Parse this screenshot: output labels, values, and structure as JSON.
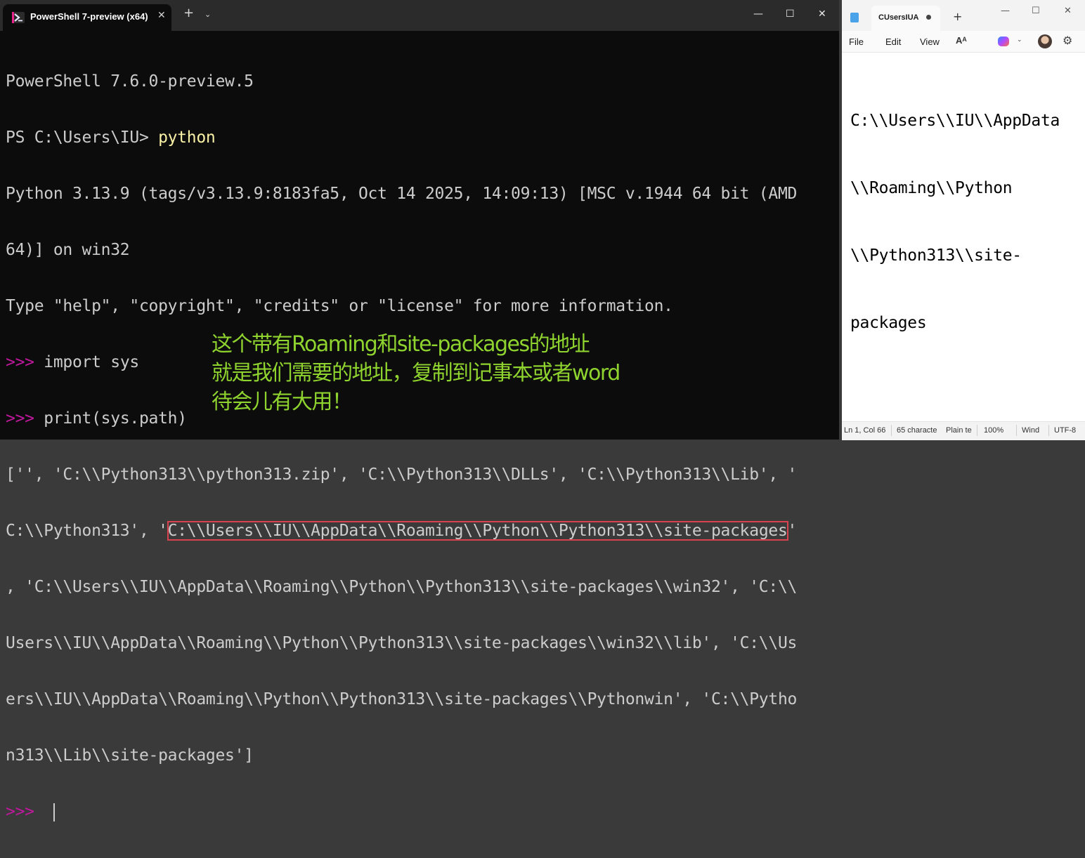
{
  "terminal": {
    "tab_title": "PowerShell 7-preview (x64)",
    "tab_close": "✕",
    "new_tab": "+",
    "dropdown": "⌄",
    "win_minimize": "—",
    "win_maximize": "☐",
    "win_close": "✕",
    "lines": [
      {
        "text": "PowerShell 7.6.0-preview.5"
      },
      {
        "prompt": "PS C:\\Users\\IU> ",
        "cmd": "python"
      },
      {
        "text": "Python 3.13.9 (tags/v3.13.9:8183fa5, Oct 14 2025, 14:09:13) [MSC v.1944 64 bit (AMD"
      },
      {
        "text": "64)] on win32"
      },
      {
        "text": "Type \"help\", \"copyright\", \"credits\" or \"license\" for more information."
      },
      {
        "prompt": ">>> ",
        "text": "import sys"
      },
      {
        "prompt": ">>> ",
        "text": "print(sys.path)"
      },
      {
        "text": "['', 'C:\\\\Python313\\\\python313.zip', 'C:\\\\Python313\\\\DLLs', 'C:\\\\Python313\\\\Lib', '"
      },
      {
        "pre": "C:\\\\Python313', '",
        "highlight": "C:\\\\Users\\\\IU\\\\AppData\\\\Roaming\\\\Python\\\\Python313\\\\site-packages",
        "post": "'"
      },
      {
        "text": ", 'C:\\\\Users\\\\IU\\\\AppData\\\\Roaming\\\\Python\\\\Python313\\\\site-packages\\\\win32', 'C:\\\\"
      },
      {
        "text": "Users\\\\IU\\\\AppData\\\\Roaming\\\\Python\\\\Python313\\\\site-packages\\\\win32\\\\lib', 'C:\\\\Us"
      },
      {
        "text": "ers\\\\IU\\\\AppData\\\\Roaming\\\\Python\\\\Python313\\\\site-packages\\\\Pythonwin', 'C:\\\\Pytho"
      },
      {
        "text": "n313\\\\Lib\\\\site-packages']"
      }
    ],
    "last_prompt": ">>> "
  },
  "annotation": {
    "line1": "这个带有Roaming和site-packages的地址",
    "line2": "就是我们需要的地址，复制到记事本或者word",
    "line3": "待会儿有大用！"
  },
  "notepad": {
    "tab_title": "CUsersIUA",
    "new_tab": "+",
    "win_minimize": "—",
    "win_maximize": "☐",
    "win_close": "✕",
    "menu": {
      "file": "File",
      "edit": "Edit",
      "view": "View"
    },
    "font_icon_text": "Aᴬ",
    "copilot_dropdown": "⌄",
    "settings_icon": "⚙",
    "content_lines": [
      "C:\\\\Users\\\\IU\\\\AppData",
      "\\\\Roaming\\\\Python",
      "\\\\Python313\\\\site-",
      "packages"
    ],
    "status": {
      "position": "Ln 1, Col 66",
      "chars": "65 characte",
      "format": "Plain te",
      "zoom": "100%",
      "line_ending": "Wind",
      "encoding": "UTF-8"
    }
  }
}
